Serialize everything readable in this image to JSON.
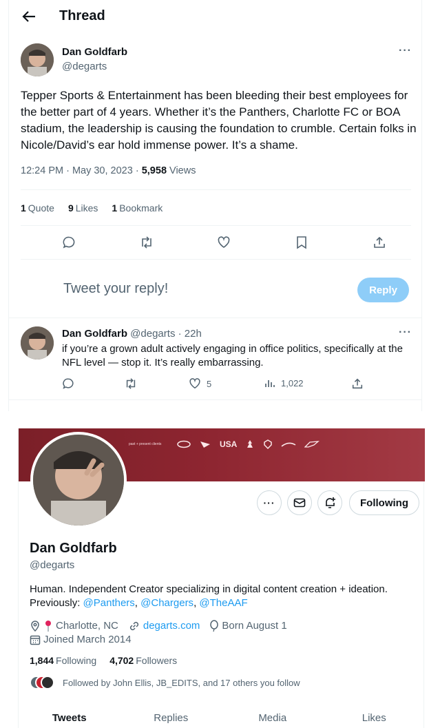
{
  "thread": {
    "title": "Thread",
    "tweet": {
      "name": "Dan Goldfarb",
      "handle": "@degarts",
      "text": "Tepper Sports & Entertainment has been bleeding their best employees for the better part of 4 years. Whether it’s the Panthers, Charlotte FC or BOA stadium, the leadership is causing the foundation to crumble. Certain folks in Nicole/David’s ear hold immense power. It’s a shame.",
      "time": "12:24 PM · May 30, 2023",
      "dot": " · ",
      "views_count": "5,958",
      "views_label": " Views",
      "quotes_count": "1",
      "quotes_label": "Quote",
      "likes_count": "9",
      "likes_label": "Likes",
      "bookmarks_count": "1",
      "bookmarks_label": "Bookmark"
    },
    "reply_box": {
      "placeholder": "Tweet your reply!",
      "button": "Reply"
    },
    "reply": {
      "name": "Dan Goldfarb",
      "handle_time": " @degarts · 22h",
      "text": "if you’re a grown adult actively engaging in office politics, specifically at the NFL level — stop it. It’s really embarrassing.",
      "likes": "5",
      "views": "1,022"
    }
  },
  "profile": {
    "banner_caption": "past + present clients",
    "banner_logos": [
      "USA"
    ],
    "follow_button": "Following",
    "name": "Dan Goldfarb",
    "handle": "@degarts",
    "bio_line1": "Human. Independent Creator specializing in digital content creation + ideation.",
    "bio_prev": "Previously: ",
    "bio_links": [
      "@Panthers",
      "@Chargers",
      "@TheAAF"
    ],
    "bio_sep": ", ",
    "location": "Charlotte, NC",
    "website": "degarts.com",
    "birthday": "Born August 1",
    "joined": "Joined March 2014",
    "following_count": "1,844",
    "following_label": "Following",
    "followers_count": "4,702",
    "followers_label": "Followers",
    "followed_by": "Followed by John Ellis, JB_EDITS, and 17 others you follow",
    "tabs": [
      "Tweets",
      "Replies",
      "Media",
      "Likes"
    ]
  },
  "colors": {
    "accent": "#1d9bf0",
    "reply_button": "#8ecdf8",
    "banner": "#8d2530",
    "text_secondary": "#536471"
  }
}
